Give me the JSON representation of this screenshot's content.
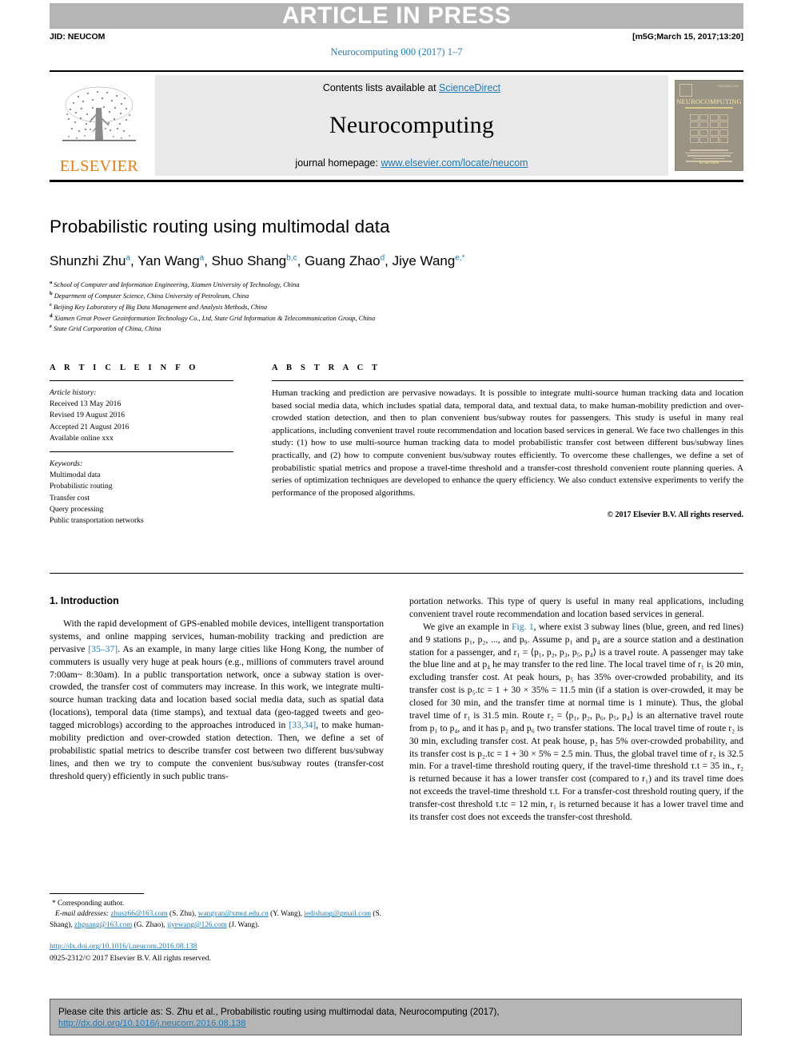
{
  "banner": {
    "text": "ARTICLE IN PRESS"
  },
  "header": {
    "jid": "JID: NEUCOM",
    "stamp": "[m5G;March 15, 2017;13:20]",
    "journal_ref": "Neurocomputing 000 (2017) 1–7"
  },
  "masthead": {
    "contents_prefix": "Contents lists available at ",
    "contents_link": "ScienceDirect",
    "journal_title": "Neurocomputing",
    "homepage_prefix": "journal homepage: ",
    "homepage_link": "www.elsevier.com/locate/neucom",
    "publisher_logo_text": "ELSEVIER",
    "cover_title": "NEUROCOMPUTING",
    "cover_issn": "ISSN 0925-2312",
    "cover_publisher": "ELSEVIER"
  },
  "article": {
    "title": "Probabilistic routing using multimodal data",
    "authors": [
      {
        "name": "Shunzhi Zhu",
        "sup": "a"
      },
      {
        "name": "Yan Wang",
        "sup": "a"
      },
      {
        "name": "Shuo Shang",
        "sup": "b,c"
      },
      {
        "name": "Guang Zhao",
        "sup": "d"
      },
      {
        "name": "Jiye Wang",
        "sup": "e,*"
      }
    ],
    "affiliations": [
      {
        "mark": "a",
        "text": "School of Computer and Information Engineering, Xiamen University of Technology, China"
      },
      {
        "mark": "b",
        "text": "Department of Computer Science, China University of Petroleum, China"
      },
      {
        "mark": "c",
        "text": "Beijing Key Laboratory of Big Data Management and Analysis Methods, China"
      },
      {
        "mark": "d",
        "text": "Xiamen Great Power Geoinformation Technology Co., Ltd, State Grid Information & Telecommunication Group, China"
      },
      {
        "mark": "e",
        "text": "State Grid Corporation of China, China"
      }
    ]
  },
  "info": {
    "heading": "A R T I C L E   I N F O",
    "history_label": "Article history:",
    "history": [
      "Received 13 May 2016",
      "Revised 19 August 2016",
      "Accepted 21 August 2016",
      "Available online xxx"
    ],
    "keywords_label": "Keywords:",
    "keywords": [
      "Multimodal data",
      "Probabilistic routing",
      "Transfer cost",
      "Query processing",
      "Public transportation networks"
    ]
  },
  "abstract": {
    "heading": "A B S T R A C T",
    "text": "Human tracking and prediction are pervasive nowadays. It is possible to integrate multi-source human tracking data and location based social media data, which includes spatial data, temporal data, and textual data, to make human-mobility prediction and over-crowded station detection, and then to plan convenient bus/subway routes for passengers. This study is useful in many real applications, including convenient travel route recommendation and location based services in general. We face two challenges in this study: (1) how to use multi-source human tracking data to model probabilistic transfer cost between different bus/subway lines practically, and (2) how to compute convenient bus/subway routes efficiently. To overcome these challenges, we define a set of probabilistic spatial metrics and propose a travel-time threshold and a transfer-cost threshold convenient route planning queries. A series of optimization techniques are developed to enhance the query efficiency. We also conduct extensive experiments to verify the performance of the proposed algorithms.",
    "copyright": "© 2017 Elsevier B.V. All rights reserved."
  },
  "body": {
    "section_heading": "1. Introduction",
    "left_para_1_a": "With the rapid development of GPS-enabled mobile devices, intelligent transportation systems, and online mapping services, human-mobility tracking and prediction are pervasive ",
    "left_ref_1": "[35–37]",
    "left_para_1_b": ". As an example, in many large cities like Hong Kong, the number of commuters is usually very huge at peak hours (e.g., millions of commuters travel around 7:00am~ 8:30am). In a public transportation network, once a subway station is over-crowded, the transfer cost of commuters may increase. In this work, we integrate multi-source human tracking data and location based social media data, such as spatial data (locations), temporal data (time stamps), and textual data (geo-tagged tweets and geo-tagged microblogs) according to the approaches introduced in ",
    "left_ref_2": "[33,34]",
    "left_para_1_c": ", to make human-mobility prediction and over-crowded station detection. Then, we define a set of probabilistic spatial metrics to describe transfer cost between two different bus/subway lines, and then we try to compute the convenient bus/subway routes (transfer-cost threshold query) efficiently in such public trans-",
    "right_para_1": "portation networks. This type of query is useful in many real applications, including convenient travel route recommendation and location based services in general.",
    "right_para_2_a": "We give an example in ",
    "right_fig_ref": "Fig. 1",
    "right_para_2_b": ", where exist 3 subway lines (blue, green, and red lines) and 9 stations p₁, p₂, ..., and p₉. Assume p₁ and p₄ are a source station and a destination station for a passenger, and r₁ = ⟨p₁, p₂, p₃, p₅, p₄⟩ is a travel route. A passenger may take the blue line and at p₄ he may transfer to the red line. The local travel time of r₁ is 20 min, excluding transfer cost. At peak hours, p₅ has 35% over-crowded probability, and its transfer cost is p₅.tc = 1 + 30 × 35% = 11.5 min (if a station is over-crowded, it may be closed for 30 min, and the transfer time at normal time is 1 minute). Thus, the global travel time of r₁ is 31.5 min. Route r₂ = ⟨p₁, p₂, p₆, p₅, p₄⟩ is an alternative travel route from p₁ to p₄, and it has p₂ and p₆ two transfer stations. The local travel time of route r₂ is 30 min, excluding transfer cost. At peak house, p₂ has 5% over-crowded probability, and its transfer cost is p₂.tc = 1 + 30 × 5% = 2.5 min. Thus, the global travel time of r₂ is 32.5 min. For a travel-time threshold routing query, if the travel-time threshold τ.t = 35 in., r₂ is returned because it has a lower transfer cost (compared to r₁) and its travel time does not exceeds the travel-time threshold τ.t. For a transfer-cost threshold routing query, if the transfer-cost threshold τ.tc = 12 min, r₁ is returned because it has a lower travel time and its transfer cost does not exceeds the transfer-cost threshold."
  },
  "footnote": {
    "corresponding": "* Corresponding author.",
    "email_label": "E-mail addresses:",
    "emails": [
      {
        "addr": "zhusz66@163.com",
        "who": "(S. Zhu),"
      },
      {
        "addr": "wangyan@xmut.edu.cn",
        "who": "(Y. Wang),"
      },
      {
        "addr": "jedishang@gmail.com",
        "who": "(S. Shang),"
      },
      {
        "addr": "zhguang@163.com",
        "who": "(G. Zhao),"
      },
      {
        "addr": "jiyewang@126.com",
        "who": "(J. Wang)."
      }
    ],
    "doi": "http://dx.doi.org/10.1016/j.neucom.2016.08.138",
    "issn_line": "0925-2312/© 2017 Elsevier B.V. All rights reserved."
  },
  "cite_box": {
    "text": "Please cite this article as: S. Zhu et al., Probabilistic routing using multimodal data, Neurocomputing (2017),",
    "doi": "http://dx.doi.org/10.1016/j.neucom.2016.08.138"
  },
  "colors": {
    "link": "#1f7bb6",
    "banner_bg": "#b5b5b5",
    "elsevier_orange": "#e87b10"
  }
}
